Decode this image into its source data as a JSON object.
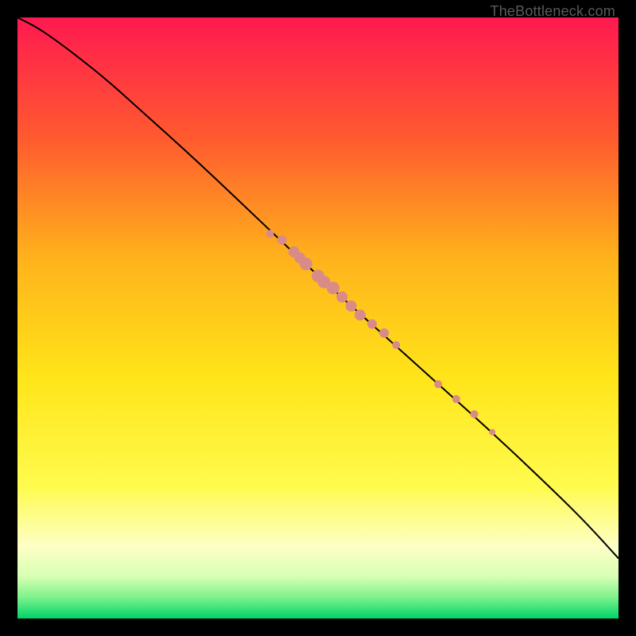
{
  "watermark": "TheBottleneck.com",
  "chart_data": {
    "type": "line",
    "title": "",
    "xlabel": "",
    "ylabel": "",
    "xlim": [
      0,
      100
    ],
    "ylim": [
      0,
      100
    ],
    "grid": false,
    "legend": false,
    "background_gradient_stops": [
      {
        "offset": 0.0,
        "color": "#ff1950"
      },
      {
        "offset": 0.2,
        "color": "#ff5a2f"
      },
      {
        "offset": 0.4,
        "color": "#ffb21b"
      },
      {
        "offset": 0.6,
        "color": "#ffe51a"
      },
      {
        "offset": 0.78,
        "color": "#fffb4d"
      },
      {
        "offset": 0.88,
        "color": "#fdffc6"
      },
      {
        "offset": 0.93,
        "color": "#d8ffb3"
      },
      {
        "offset": 0.965,
        "color": "#7cf28c"
      },
      {
        "offset": 1.0,
        "color": "#00d36a"
      }
    ],
    "series": [
      {
        "name": "curve",
        "type": "line",
        "x": [
          0,
          3,
          6,
          10,
          15,
          20,
          30,
          40,
          50,
          60,
          70,
          80,
          90,
          95,
          100
        ],
        "y": [
          100,
          98.5,
          96.5,
          93.5,
          89.5,
          85,
          76,
          66.5,
          57,
          48,
          39,
          30,
          20.5,
          15.5,
          10
        ]
      },
      {
        "name": "cluster-upper",
        "type": "scatter",
        "color": "#d98b87",
        "points": [
          {
            "x": 42,
            "y": 64,
            "r": 5
          },
          {
            "x": 44,
            "y": 63,
            "r": 6
          },
          {
            "x": 46,
            "y": 61,
            "r": 7
          },
          {
            "x": 47,
            "y": 60,
            "r": 7
          },
          {
            "x": 48,
            "y": 59,
            "r": 8
          },
          {
            "x": 50,
            "y": 57,
            "r": 8
          },
          {
            "x": 51,
            "y": 56,
            "r": 8
          },
          {
            "x": 52.5,
            "y": 55,
            "r": 8
          },
          {
            "x": 54,
            "y": 53.5,
            "r": 7
          },
          {
            "x": 55.5,
            "y": 52,
            "r": 7
          },
          {
            "x": 57,
            "y": 50.5,
            "r": 7
          },
          {
            "x": 59,
            "y": 49,
            "r": 6
          },
          {
            "x": 61,
            "y": 47.5,
            "r": 6
          },
          {
            "x": 63,
            "y": 45.5,
            "r": 5
          }
        ]
      },
      {
        "name": "cluster-lower",
        "type": "scatter",
        "color": "#d98b87",
        "points": [
          {
            "x": 70,
            "y": 39,
            "r": 5
          },
          {
            "x": 73,
            "y": 36.5,
            "r": 5
          },
          {
            "x": 76,
            "y": 34,
            "r": 5
          },
          {
            "x": 79,
            "y": 31,
            "r": 4
          }
        ]
      }
    ]
  }
}
